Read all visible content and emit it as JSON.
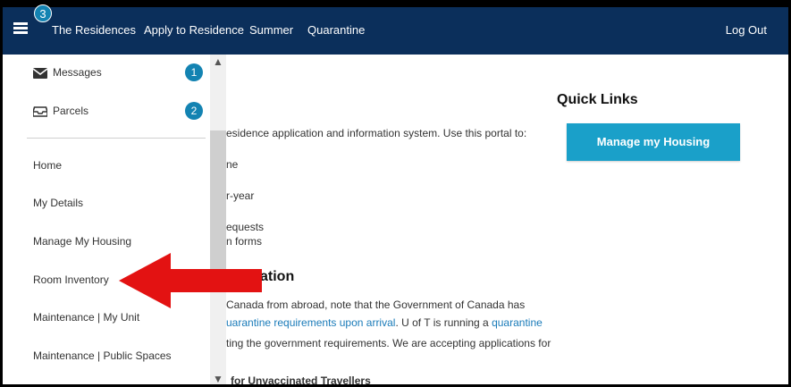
{
  "topbar": {
    "notification_count": "3",
    "nav": [
      "The Residences",
      "Apply to Residence",
      "Summer",
      "Quarantine"
    ],
    "logout_label": "Log Out"
  },
  "drawer": {
    "messages_label": "Messages",
    "messages_count": "1",
    "parcels_label": "Parcels",
    "parcels_count": "2",
    "items": [
      "Home",
      "My Details",
      "Manage My Housing",
      "Room Inventory",
      "Maintenance | My Unit",
      "Maintenance | Public Spaces"
    ]
  },
  "main": {
    "intro_fragment": "esidence application and information system. Use this portal to:",
    "list_fragments": [
      "ne",
      "r-year",
      "equests",
      "n forms"
    ],
    "section_heading_fragment": "ation",
    "paragraph_line1": "Canada from abroad, note that the Government of Canada has",
    "paragraph_line2_link": "uarantine requirements upon arrival",
    "paragraph_line2_text": ". U of T is running a ",
    "paragraph_line2_link2": "quarantine",
    "paragraph_line3": "ting the government requirements. We are accepting applications for",
    "subheading_fragment": "for Unvaccinated Travellers"
  },
  "quick_links": {
    "title": "Quick Links",
    "manage_button": "Manage my Housing"
  },
  "colors": {
    "topbar": "#0b2f5b",
    "badge": "#1383b2",
    "button": "#1aa0c9",
    "arrow": "#e31212",
    "link": "#1a7bb9"
  }
}
